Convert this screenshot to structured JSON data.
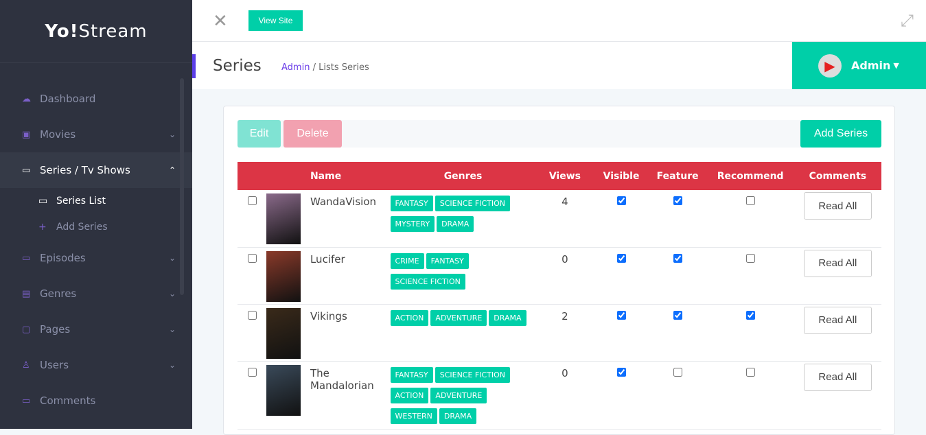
{
  "logo": {
    "bold": "Yo!",
    "rest": "Stream"
  },
  "sidebar": {
    "items": [
      {
        "label": "Dashboard",
        "icon": "dashboard-icon",
        "chev": ""
      },
      {
        "label": "Movies",
        "icon": "movie-icon",
        "chev": "⌄"
      },
      {
        "label": "Series / Tv Shows",
        "icon": "tv-icon",
        "chev": "⌃"
      },
      {
        "label": "Episodes",
        "icon": "tv-icon",
        "chev": "⌄"
      },
      {
        "label": "Genres",
        "icon": "book-icon",
        "chev": "⌄"
      },
      {
        "label": "Pages",
        "icon": "page-icon",
        "chev": "⌄"
      },
      {
        "label": "Users",
        "icon": "user-icon",
        "chev": "⌄"
      },
      {
        "label": "Comments",
        "icon": "comment-icon",
        "chev": ""
      }
    ],
    "sub": [
      {
        "label": "Series List"
      },
      {
        "label": "Add Series"
      }
    ]
  },
  "topbar": {
    "view_site": "View Site"
  },
  "header": {
    "title": "Series",
    "crumb_home": "Admin",
    "crumb_sep": "/",
    "crumb_current": "Lists Series",
    "user": "Admin"
  },
  "toolbar": {
    "edit": "Edit",
    "delete": "Delete",
    "add": "Add Series"
  },
  "table": {
    "headers": [
      "Name",
      "Genres",
      "Views",
      "Visible",
      "Feature",
      "Recommend",
      "Comments"
    ],
    "rows": [
      {
        "name": "WandaVision",
        "genres": [
          "FANTASY",
          "SCIENCE FICTION",
          "MYSTERY",
          "DRAMA"
        ],
        "views": "4",
        "visible": true,
        "feature": true,
        "recommend": false,
        "comments": "Read All",
        "color": "#8a6a8a"
      },
      {
        "name": "Lucifer",
        "genres": [
          "CRIME",
          "FANTASY",
          "SCIENCE FICTION"
        ],
        "views": "0",
        "visible": true,
        "feature": true,
        "recommend": false,
        "comments": "Read All",
        "color": "#8a3a2a"
      },
      {
        "name": "Vikings",
        "genres": [
          "ACTION",
          "ADVENTURE",
          "DRAMA"
        ],
        "views": "2",
        "visible": true,
        "feature": true,
        "recommend": true,
        "comments": "Read All",
        "color": "#3a2a1a"
      },
      {
        "name": "The Mandalorian",
        "genres": [
          "FANTASY",
          "SCIENCE FICTION",
          "ACTION",
          "ADVENTURE",
          "WESTERN",
          "DRAMA"
        ],
        "views": "0",
        "visible": true,
        "feature": false,
        "recommend": false,
        "comments": "Read All",
        "color": "#3a4a5a"
      }
    ]
  }
}
